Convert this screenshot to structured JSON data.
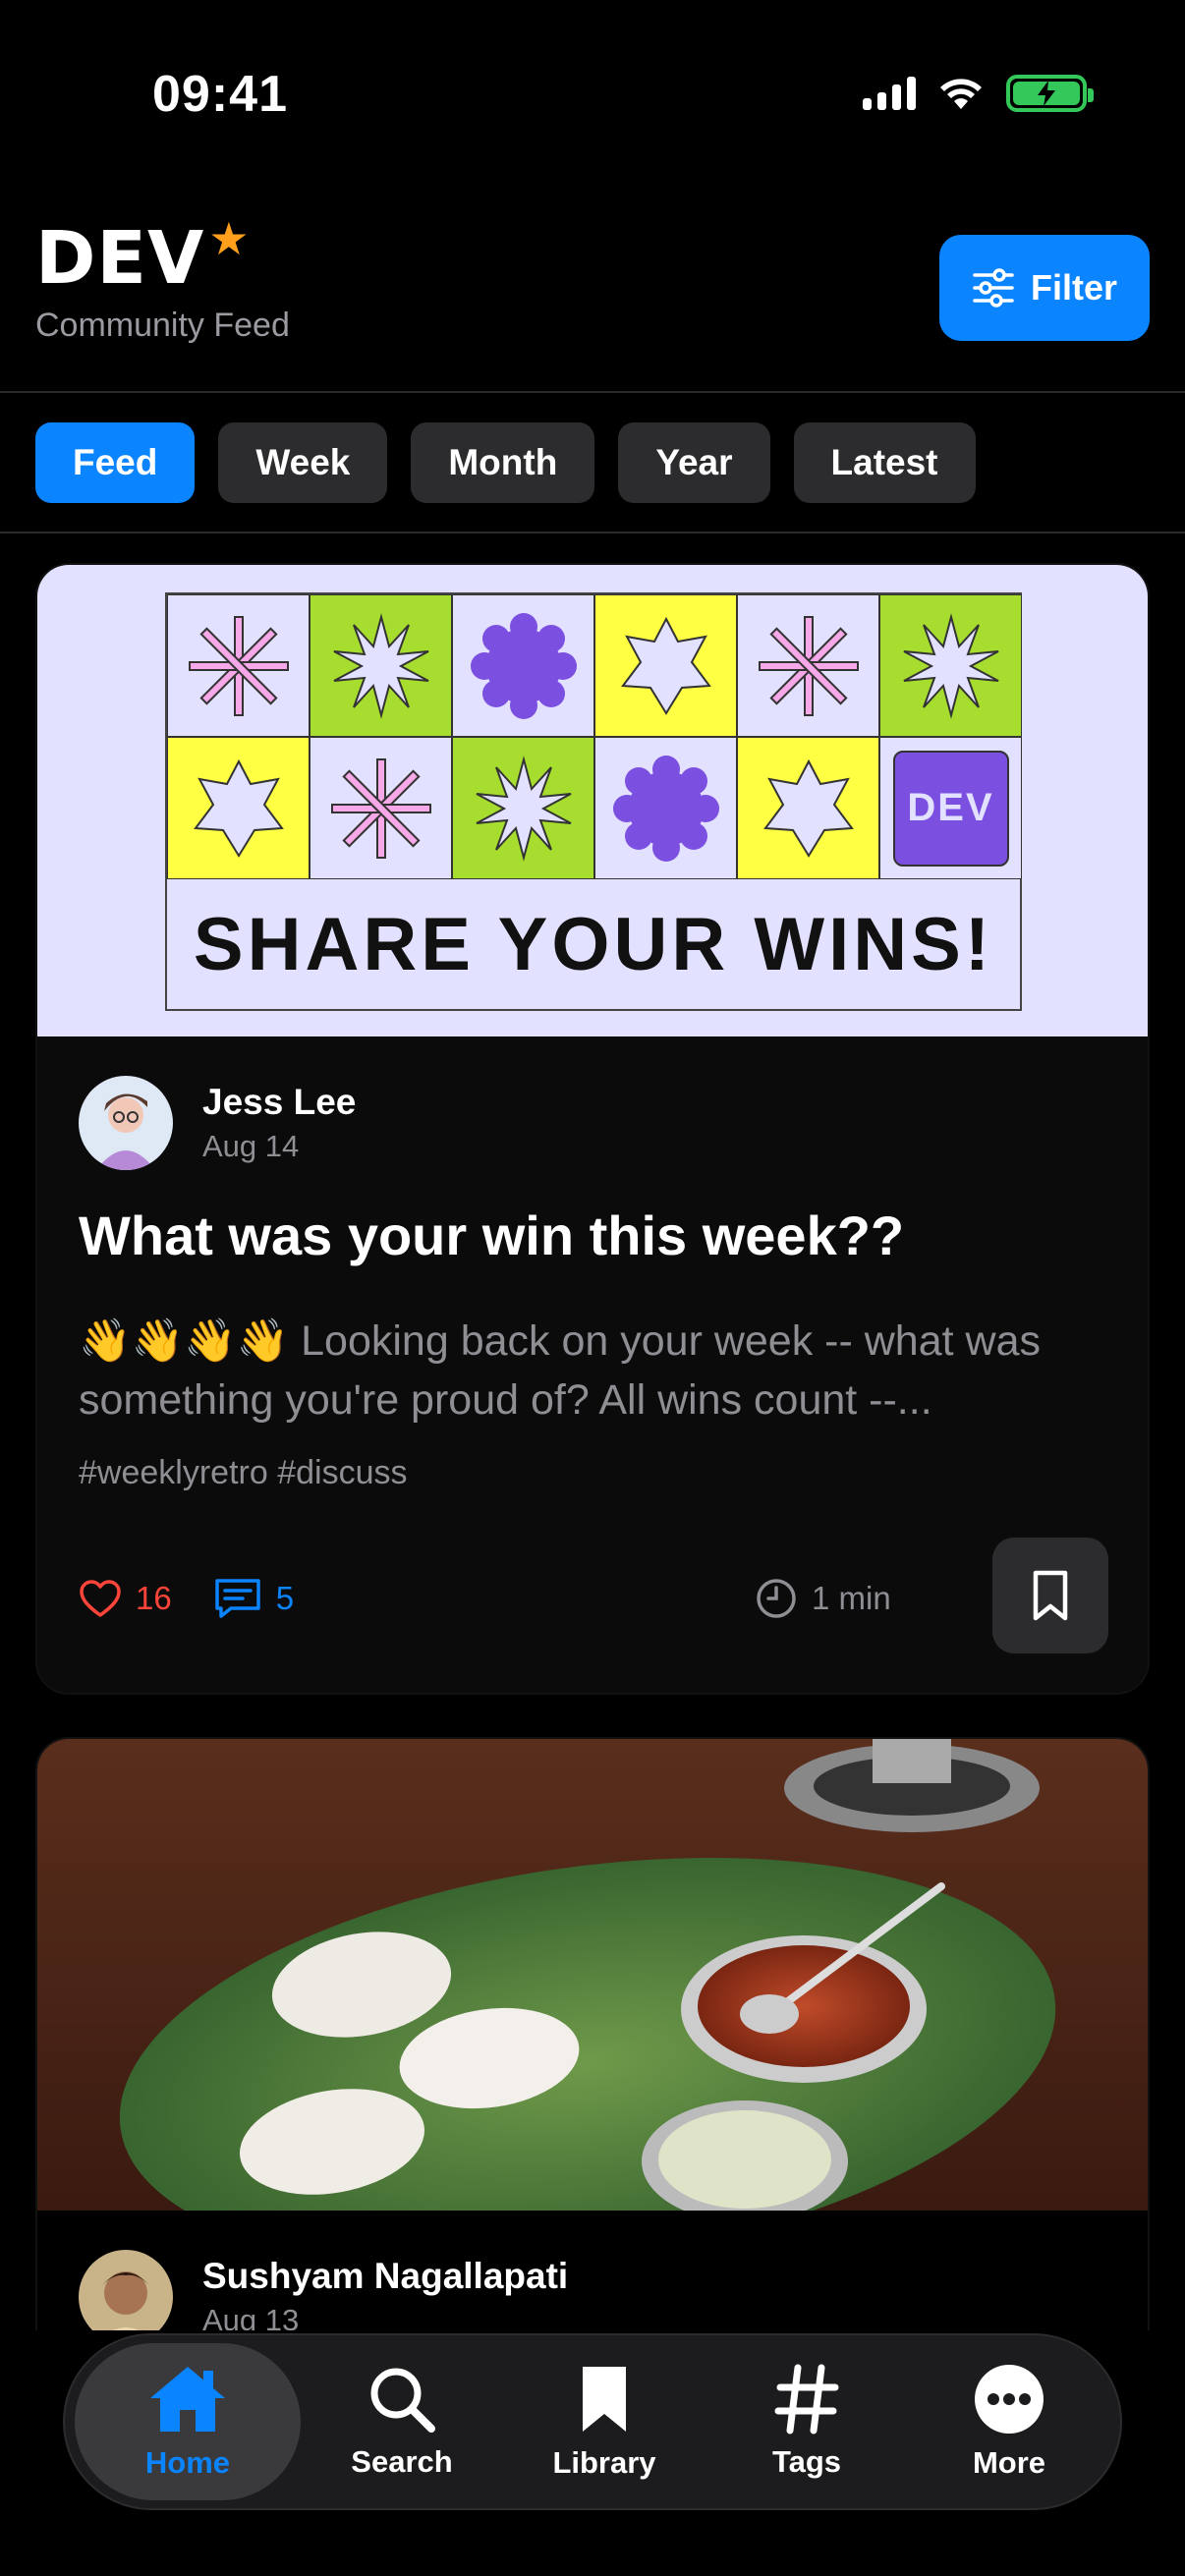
{
  "status_bar": {
    "time": "09:41"
  },
  "header": {
    "logo": "DEV",
    "logo_star": "★",
    "subtitle": "Community Feed",
    "filter_label": "Filter"
  },
  "tabs": [
    {
      "label": "Feed",
      "active": true
    },
    {
      "label": "Week",
      "active": false
    },
    {
      "label": "Month",
      "active": false
    },
    {
      "label": "Year",
      "active": false
    },
    {
      "label": "Latest",
      "active": false
    }
  ],
  "posts": [
    {
      "banner_text": "SHARE YOUR WINS!",
      "banner_logo": "DEV",
      "author": "Jess Lee",
      "date": "Aug 14",
      "title": "What was your win this week??",
      "excerpt_emoji": "👋👋👋👋",
      "excerpt": " Looking back on your week -- what was something you're proud of? All wins count --...",
      "tags": "#weeklyretro #discuss",
      "likes": "16",
      "comments": "5",
      "read_time": "1 min"
    },
    {
      "author": "Sushyam Nagallapati",
      "date": "Aug 13"
    }
  ],
  "tab_bar": [
    {
      "label": "Home",
      "icon": "home-icon",
      "active": true
    },
    {
      "label": "Search",
      "icon": "search-icon",
      "active": false
    },
    {
      "label": "Library",
      "icon": "bookmark-icon",
      "active": false
    },
    {
      "label": "Tags",
      "icon": "hashtag-icon",
      "active": false
    },
    {
      "label": "More",
      "icon": "more-icon",
      "active": false
    }
  ],
  "colors": {
    "accent": "#0a84ff",
    "like": "#ff453a",
    "star": "#ff9f1c",
    "banner_bg": "#e2e1ff",
    "lime": "#a6dd2e",
    "yellow": "#ffff44",
    "purple": "#7b4fe0"
  }
}
